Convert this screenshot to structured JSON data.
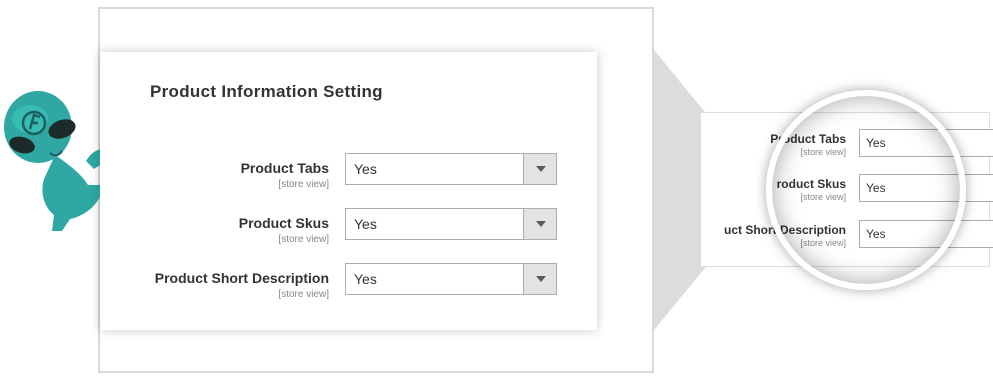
{
  "panel": {
    "title": "Product Information Setting",
    "rows": [
      {
        "label": "Product Tabs",
        "scope": "[store view]",
        "value": "Yes"
      },
      {
        "label": "Product Skus",
        "scope": "[store view]",
        "value": "Yes"
      },
      {
        "label": "Product Short Description",
        "scope": "[store view]",
        "value": "Yes"
      }
    ]
  },
  "zoom": {
    "rows": [
      {
        "label": "Product Tabs",
        "scope": "[store view]",
        "value": "Yes"
      },
      {
        "label": "roduct Skus",
        "scope": "[store view]",
        "value": "Yes"
      },
      {
        "label": "uct Short Description",
        "scope": "[store view]",
        "value": "Yes"
      }
    ]
  },
  "colors": {
    "mascot": "#2fa8a3",
    "accent_border": "#adadad",
    "dropdown_button": "#e3e3e3"
  },
  "icons": {
    "dropdown": "chevron-down-icon",
    "mascot": "alien-mascot-icon"
  }
}
